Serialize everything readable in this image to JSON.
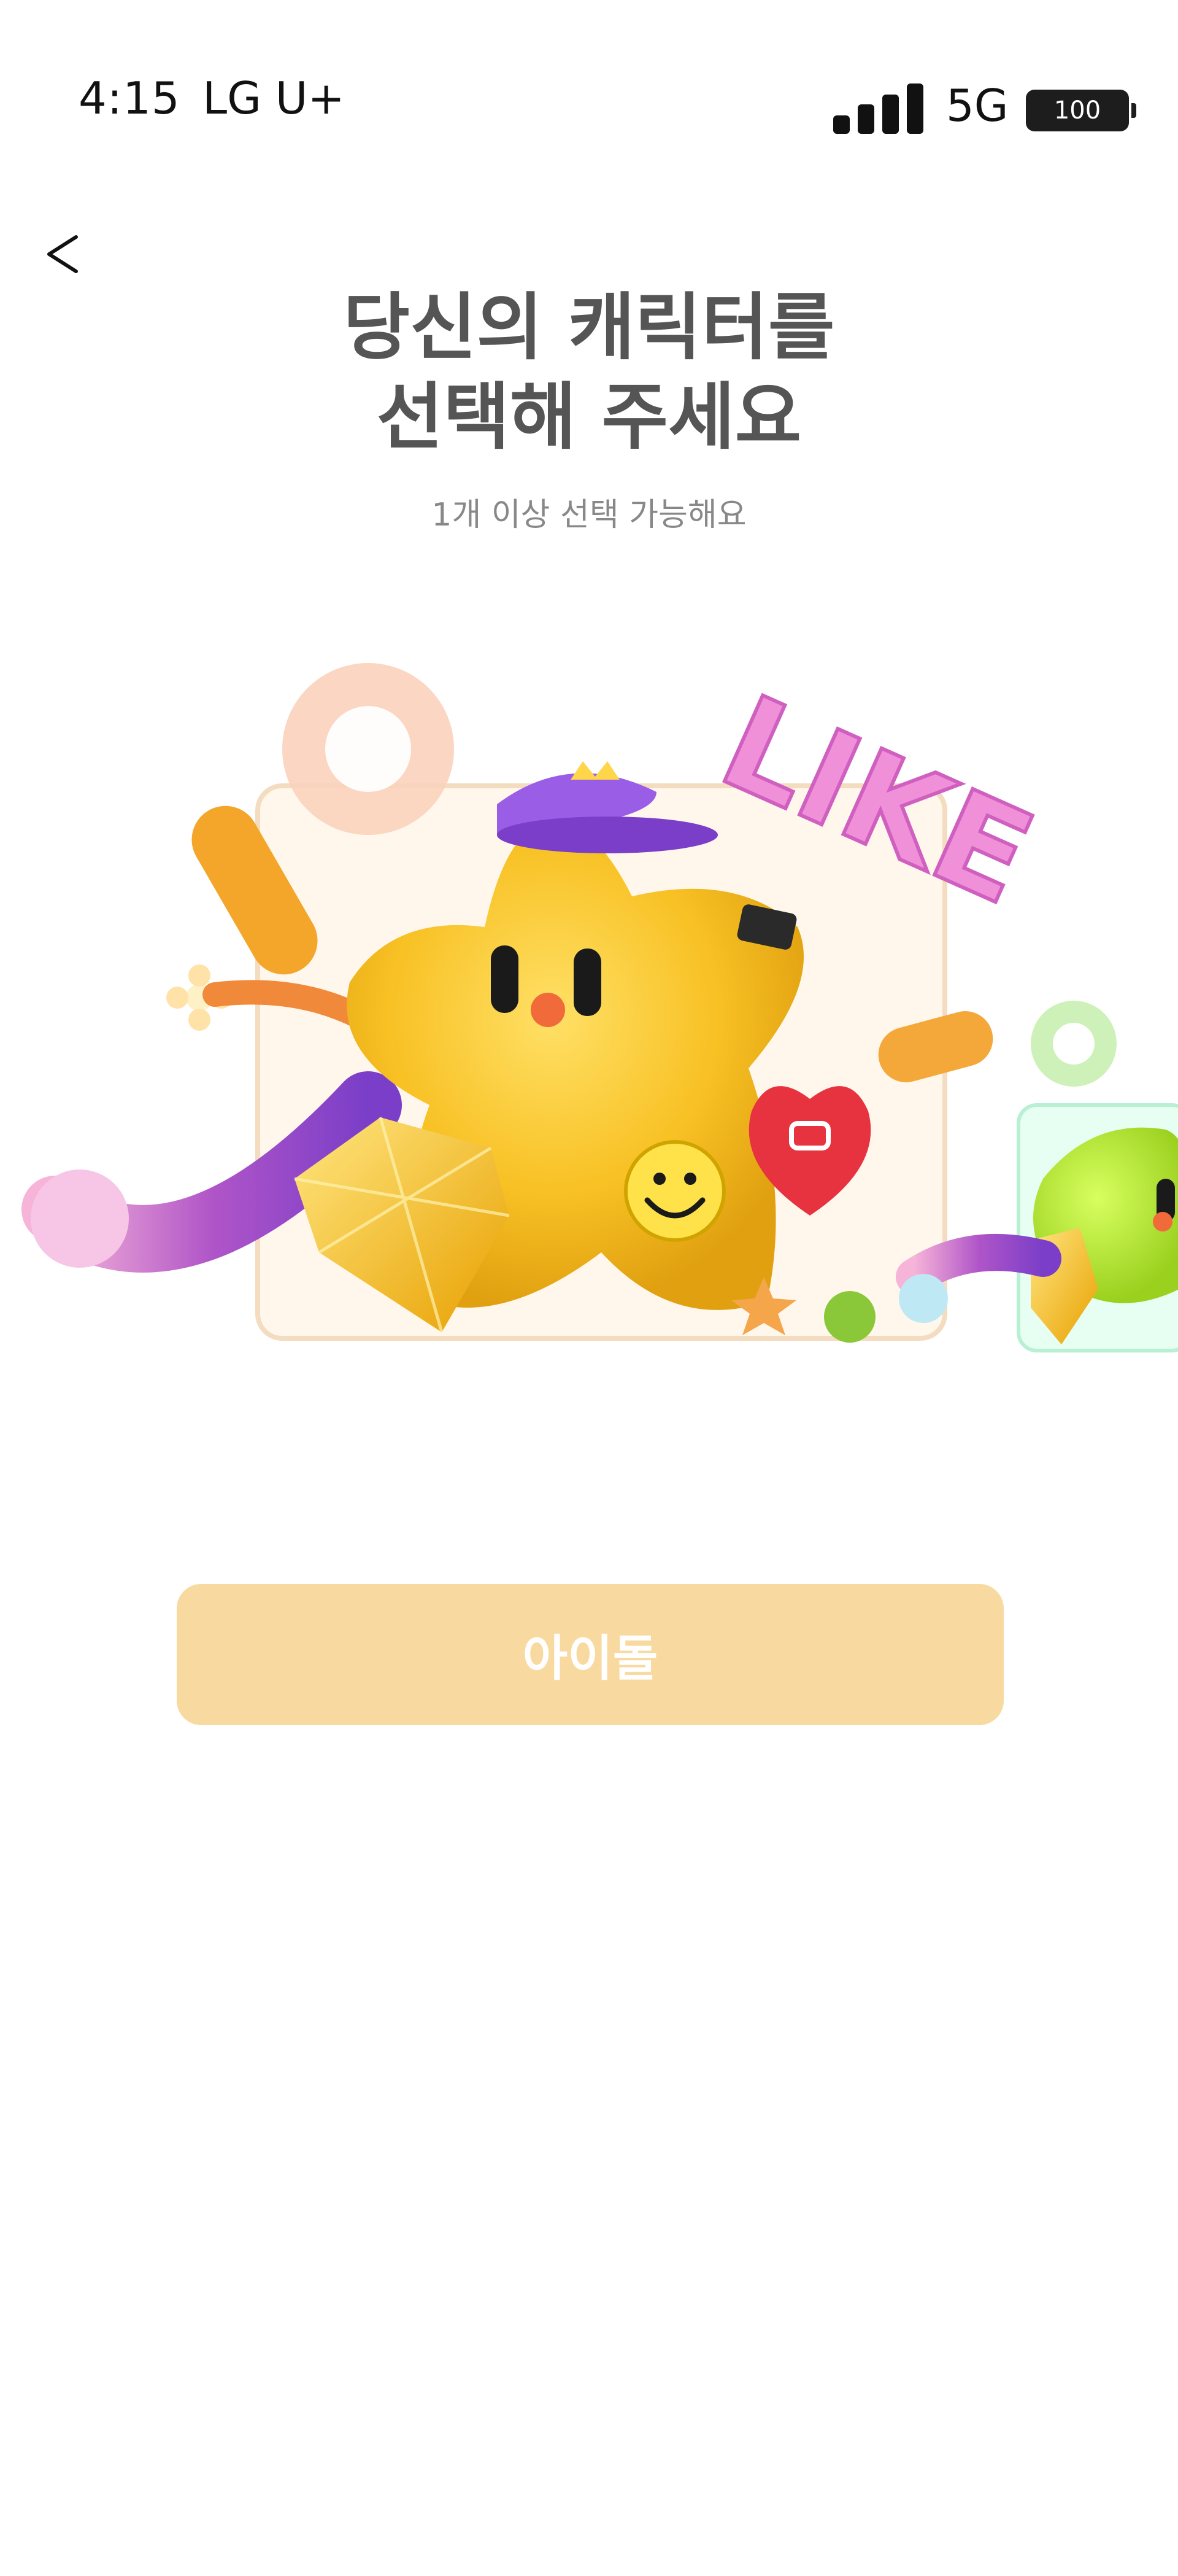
{
  "status_bar": {
    "time": "4:15",
    "carrier": "LG U+",
    "network": "5G",
    "battery": "100"
  },
  "header": {
    "back_icon": "chevron-left-icon"
  },
  "title": {
    "line1": "당신의 캐릭터를",
    "line2": "선택해 주세요",
    "subtitle": "1개 이상 선택 가능해요"
  },
  "carousel": {
    "items": [
      {
        "name": "yellow-star-character"
      },
      {
        "name": "green-star-character"
      }
    ],
    "sign_text": "LIKE"
  },
  "select_button": {
    "label": "아이돌",
    "color": "#f8d9a0"
  }
}
